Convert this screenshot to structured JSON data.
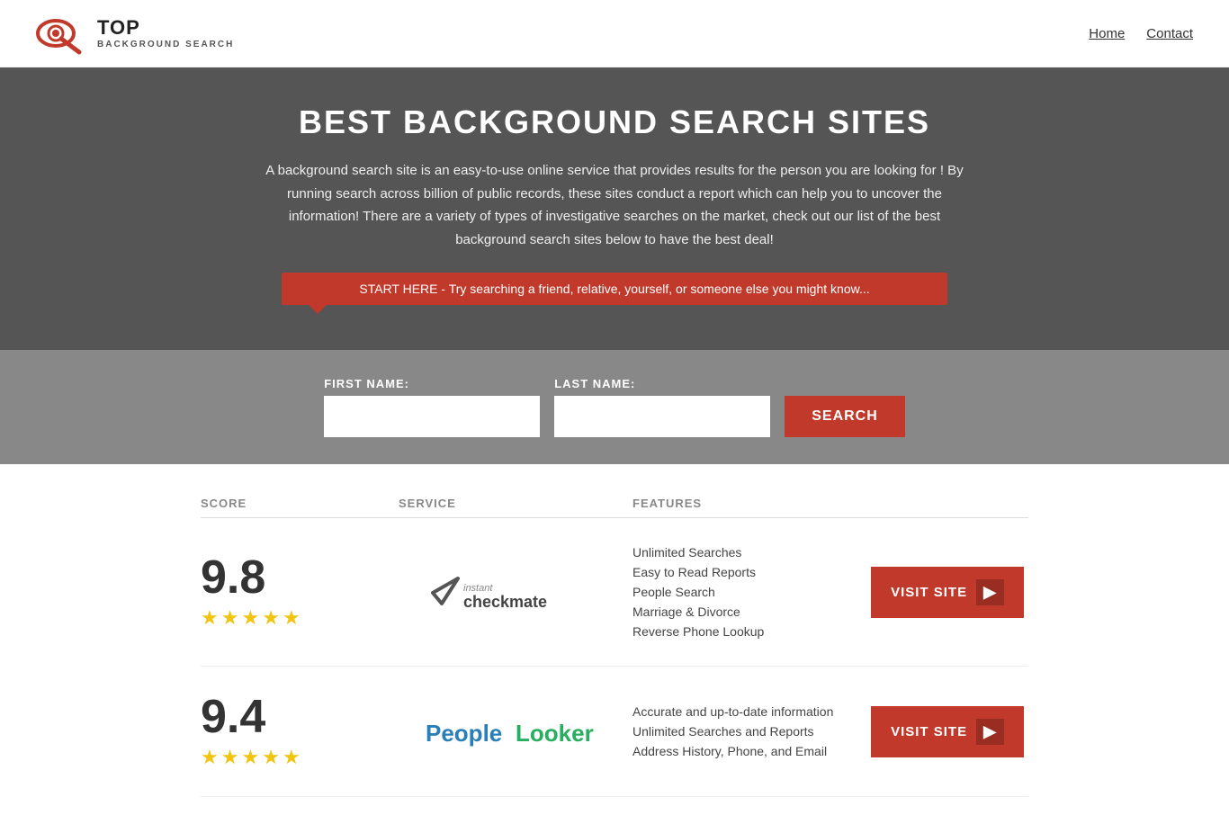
{
  "header": {
    "logo_top": "TOP",
    "logo_sub": "BACKGROUND SEARCH",
    "nav": [
      {
        "label": "Home",
        "id": "nav-home"
      },
      {
        "label": "Contact",
        "id": "nav-contact"
      }
    ]
  },
  "hero": {
    "title": "BEST BACKGROUND SEARCH SITES",
    "description": "A background search site is an easy-to-use online service that provides results  for the person you are looking for ! By  running  search across billion of public records, these sites conduct  a report which can help you to uncover the information! There are a variety of types of investigative searches on the market, check out our  list of the best background search sites below to have the best deal!",
    "callout": "START HERE - Try searching a friend, relative, yourself, or someone else you might know..."
  },
  "search_form": {
    "first_name_label": "FIRST NAME:",
    "last_name_label": "LAST NAME:",
    "first_name_placeholder": "",
    "last_name_placeholder": "",
    "search_button": "SEARCH"
  },
  "table": {
    "headers": [
      "SCORE",
      "SERVICE",
      "FEATURES",
      ""
    ],
    "rows": [
      {
        "score": "9.8",
        "stars": 4.5,
        "service_name": "Instant Checkmate",
        "service_id": "checkmate",
        "features": [
          "Unlimited Searches",
          "Easy to Read Reports",
          "People Search",
          "Marriage & Divorce",
          "Reverse Phone Lookup"
        ],
        "visit_label": "VISIT SITE"
      },
      {
        "score": "9.4",
        "stars": 4.5,
        "service_name": "PeopleLooker",
        "service_id": "peoplelooker",
        "features": [
          "Accurate and up-to-date information",
          "Unlimited Searches and Reports",
          "Address History, Phone, and Email"
        ],
        "visit_label": "VISIT SITE"
      }
    ]
  },
  "colors": {
    "accent": "#c0392b",
    "star": "#f1c40f",
    "hero_bg": "#555555"
  }
}
